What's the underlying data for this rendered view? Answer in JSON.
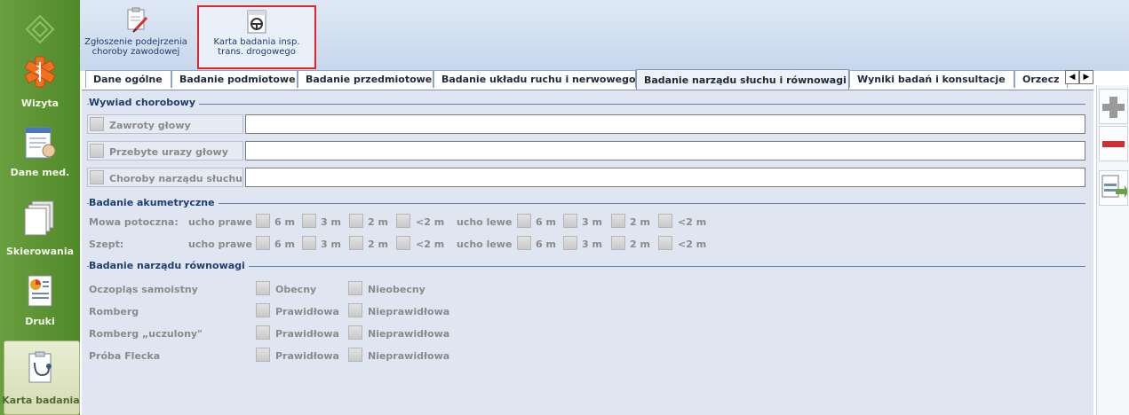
{
  "nav": {
    "items": [
      {
        "label": "Wizyta",
        "icon": "medical-star-icon"
      },
      {
        "label": "Dane med.",
        "icon": "medical-data-icon"
      },
      {
        "label": "Skierowania",
        "icon": "referrals-icon"
      },
      {
        "label": "Druki",
        "icon": "print-forms-icon"
      },
      {
        "label": "Karta badania",
        "icon": "exam-card-icon"
      }
    ]
  },
  "ribbon": {
    "buttons": [
      {
        "line1": "Zgłoszenie podejrzenia",
        "line2": "choroby zawodowej"
      },
      {
        "line1": "Karta badania insp.",
        "line2": "trans. drogowego"
      }
    ]
  },
  "tabs": [
    "Dane ogólne",
    "Badanie podmiotowe",
    "Badanie przedmiotowe",
    "Badanie układu ruchu i nerwowego",
    "Badanie narządu słuchu i równowagi",
    "Wyniki badań i konsultacje",
    "Orzecz"
  ],
  "sections": {
    "wywiad": "Wywiad chorobowy",
    "akumetryczne": "Badanie akumetryczne",
    "rownowagi": "Badanie narządu równowagi"
  },
  "wywiad_rows": [
    {
      "label": "Zawroty głowy",
      "value": ""
    },
    {
      "label": "Przebyte urazy głowy",
      "value": ""
    },
    {
      "label": "Choroby narządu słuchu",
      "value": ""
    }
  ],
  "akumetryczne": {
    "rows": [
      {
        "label": "Mowa potoczna:"
      },
      {
        "label": "Szept:"
      }
    ],
    "ear_right": "ucho prawe",
    "ear_left": "ucho lewe",
    "distances": [
      "6 m",
      "3 m",
      "2 m",
      "<2 m"
    ]
  },
  "rownowagi_rows": [
    {
      "label": "Oczopląs samoistny",
      "opt1": "Obecny",
      "opt2": "Nieobecny"
    },
    {
      "label": "Romberg",
      "opt1": "Prawidłowa",
      "opt2": "Nieprawidłowa"
    },
    {
      "label": "Romberg „uczulony\"",
      "opt1": "Prawidłowa",
      "opt2": "Nieprawidłowa"
    },
    {
      "label": "Próba Flecka",
      "opt1": "Prawidłowa",
      "opt2": "Nieprawidłowa"
    }
  ],
  "colors": {
    "nav_green": "#5a9131",
    "ribbon_blue": "#c7d7ec",
    "panel_bg": "#dfe6f2",
    "highlight_red": "#e0252c",
    "section_blue": "#1e3f6e"
  }
}
